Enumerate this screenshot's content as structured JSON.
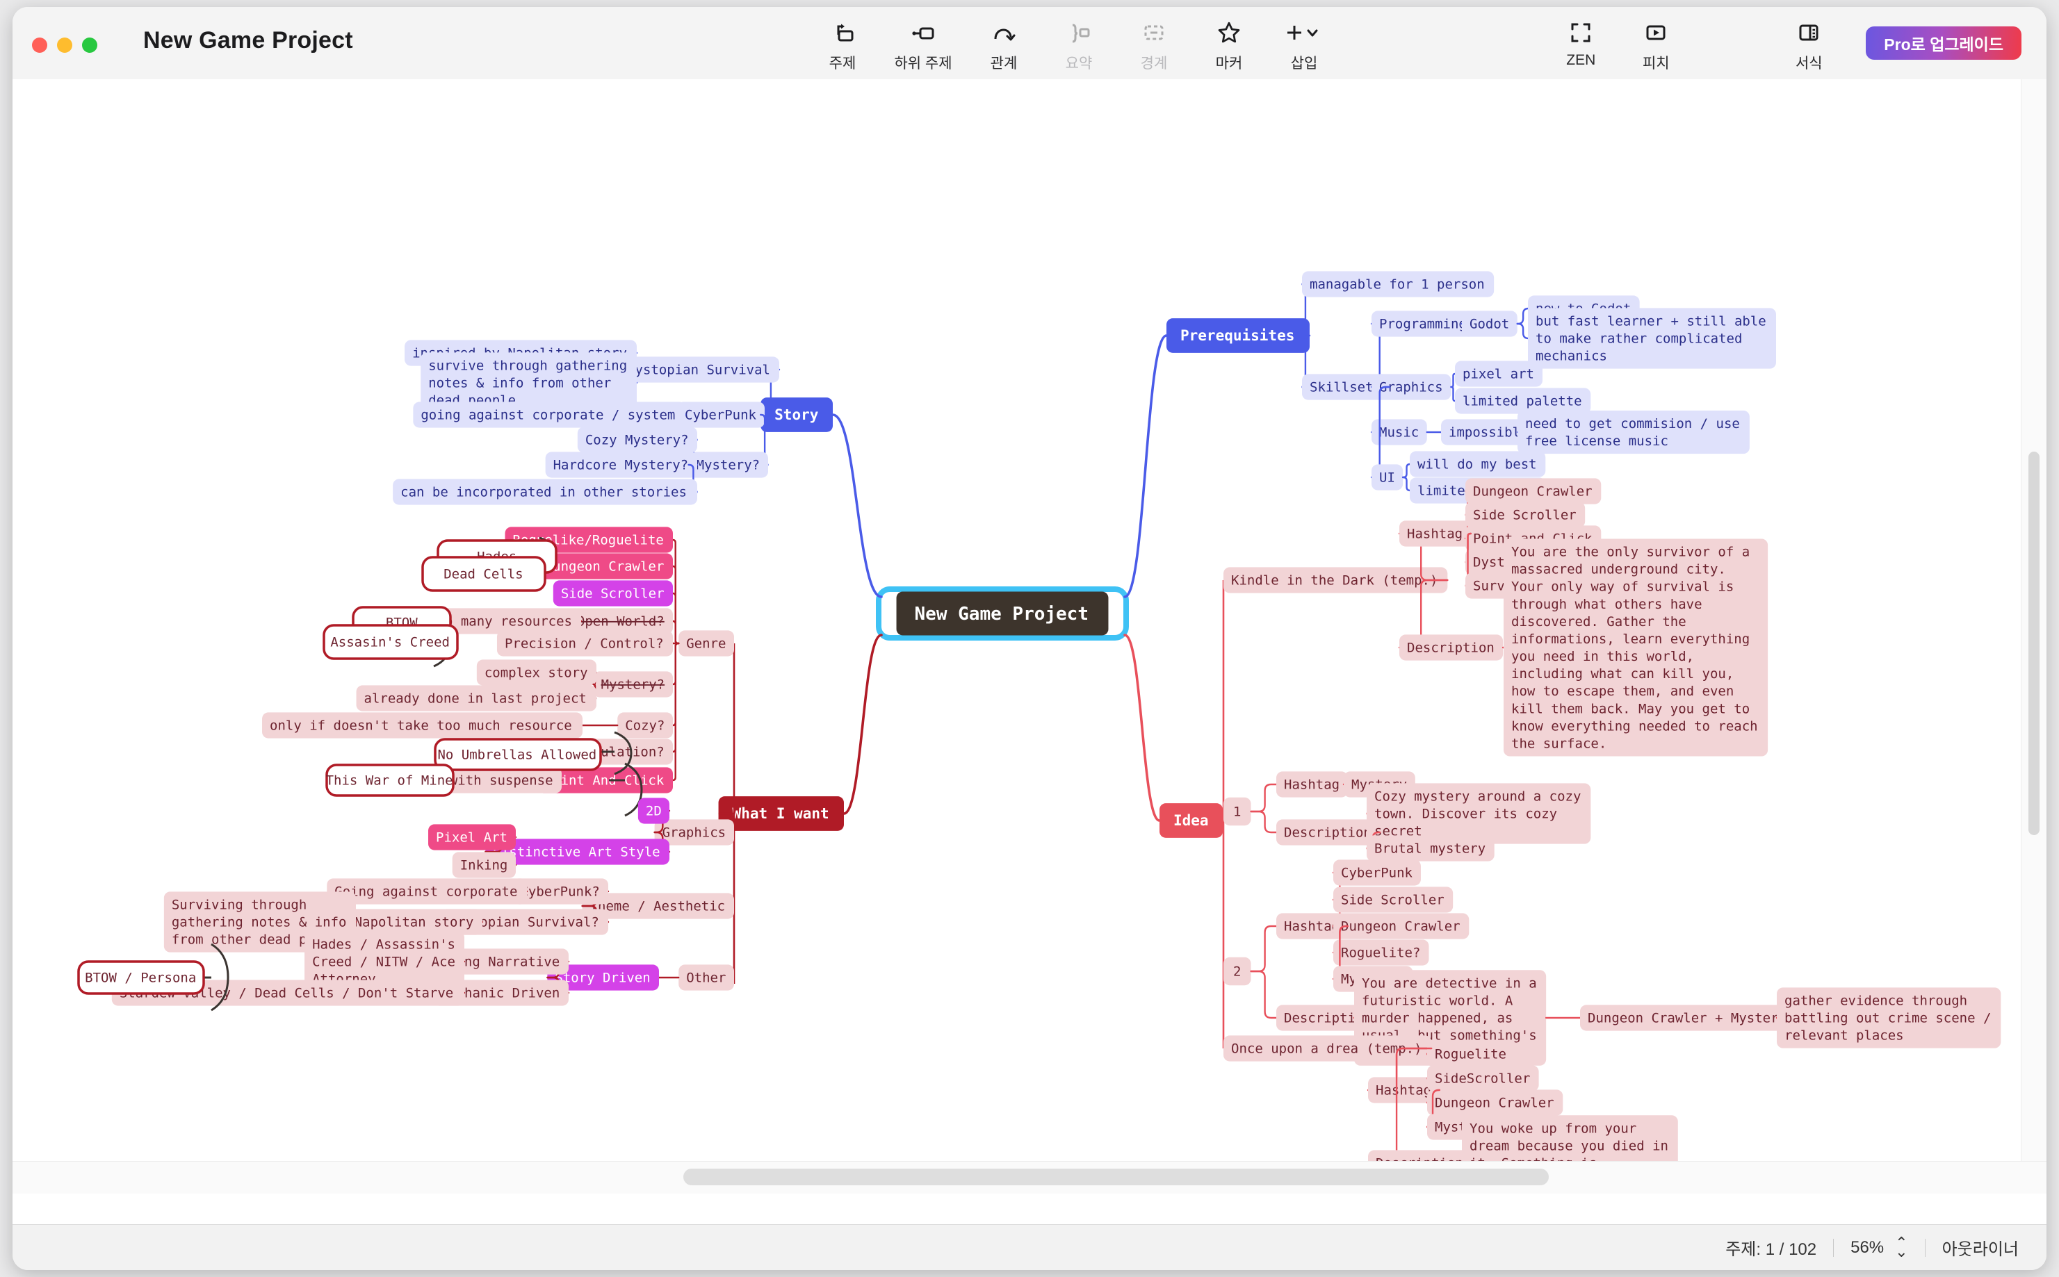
{
  "window": {
    "document_title": "New Game Project",
    "traffic_lights": [
      "close",
      "minimize",
      "zoom"
    ]
  },
  "toolbar": {
    "items": [
      {
        "label": "주제",
        "icon": "topic-icon",
        "disabled": false
      },
      {
        "label": "하위 주제",
        "icon": "subtopic-icon",
        "disabled": false
      },
      {
        "label": "관계",
        "icon": "relationship-icon",
        "disabled": false
      },
      {
        "label": "요약",
        "icon": "summary-icon",
        "disabled": true
      },
      {
        "label": "경계",
        "icon": "boundary-icon",
        "disabled": true
      },
      {
        "label": "마커",
        "icon": "star-marker-icon",
        "disabled": false
      },
      {
        "label": "삽입",
        "icon": "insert-plus-icon",
        "disabled": false
      }
    ],
    "right_items": [
      {
        "label": "ZEN",
        "icon": "zen-icon"
      },
      {
        "label": "피치",
        "icon": "pitch-play-icon"
      },
      {
        "label": "서식",
        "icon": "format-panel-icon"
      }
    ],
    "upgrade_label": "Pro로 업그레이드"
  },
  "statusbar": {
    "topic_count": "주제: 1 / 102",
    "zoom": "56%",
    "outliner": "아웃라이너",
    "stepper_icon": "chevron-up-down-icon"
  },
  "colors": {
    "root_fill": "#3d342c",
    "root_text": "#ffffff",
    "selection_ring": "#3fc2f5",
    "blue_branch": "#4a5be8",
    "blue_node": "#dfe1fb",
    "blue_text": "#2b2f8a",
    "dark_red": "#b01b26",
    "coral_red": "#e8505b",
    "pink_node": "#f2d4d6",
    "pink_text": "#6e2430",
    "hot_pink": "#ef4a87",
    "magenta": "#d442e8",
    "boundary_stroke": "#b01b26",
    "bracket_stroke": "#3a3430"
  },
  "mindmap": {
    "root": {
      "text": "New Game Project",
      "selected": true
    },
    "branches": [
      {
        "name": "Prerequisites",
        "color": "blue"
      },
      {
        "name": "Story",
        "color": "blue"
      },
      {
        "name": "What I want",
        "color": "dark_red"
      },
      {
        "name": "Idea",
        "color": "coral_red"
      }
    ],
    "nodes": {
      "prerequisites": "Prerequisites",
      "managable": "managable for 1 person",
      "skillsets": "Skillsets",
      "programming": "Programming",
      "godot": "Godot",
      "new_to_godot": "new to Godot",
      "fast_learner": "but fast learner + still able to make rather complicated mechanics",
      "graphics_pre": "Graphics",
      "pixel_art_pre": "pixel art",
      "limited_palette_1": "limited palette",
      "music": "Music",
      "impossible": "impossible",
      "commision": "need to get commision / use free license music",
      "ui": "UI",
      "will_do_best": "will do my best",
      "limited_palette_2": "limited palette",
      "story": "Story",
      "dystopian_survival": "Dystopian Survival",
      "inspired_napolitan": "inspired by Napolitan story",
      "survive_gathering": "survive through gathering notes & info from other dead people",
      "cyberpunk": "CyberPunk",
      "going_against": "going against corporate / system",
      "mystery_q": "Mystery?",
      "cozy_mystery_q": "Cozy Mystery?",
      "hardcore_mystery_q": "Hardcore Mystery?",
      "can_be_incorporated": "can be incorporated in other stories",
      "what_i_want": "What I want",
      "genre": "Genre",
      "roguelike": "Roguelike/Roguelite",
      "dungeon_crawler_g": "Dungeon Crawler",
      "side_scroller_g": "Side Scroller",
      "hades": "Hades",
      "dead_cells": "Dead Cells",
      "open_world_q": "Open World?",
      "too_many_resources": "too many resources",
      "btow": "BTOW",
      "assasins_creed": "Assasin's Creed",
      "precision_control_q": "Precision / Control?",
      "mystery_q2": "Mystery?",
      "complex_story": "complex story",
      "already_done": "already done in last project",
      "cozy_q": "Cozy?",
      "only_if_doesnt": "only if doesn't take too much resource",
      "simulation_q": "Simulation?",
      "no_umbrellas": "No Umbrellas Allowed",
      "point_and_click_g": "Point And Click",
      "with_suspense": "with suspense",
      "this_war_of_mine": "This War of Mine",
      "graphics_w": "Graphics",
      "two_d": "2D",
      "distinctive_art": "Distinctive Art Style",
      "pixel_art_w": "Pixel Art",
      "inking": "Inking",
      "theme_aesthetic": "Theme / Aesthetic",
      "cyberpunk_q": "CyberPunk?",
      "going_against_corp": "Going against corporate",
      "dystopian_survival_q": "Dystopian Survival?",
      "napolitan_story": "Napolitan story",
      "surviving_through": "Surviving through gathering notes & info from other dead people",
      "other": "Other",
      "story_driven": "Story Driven",
      "strong_narrative": "Strong Narrative",
      "hades_ac_nitw": "Hades / Assassin's Creed / NITW / Ace Attorney",
      "mechanic_driven": "Mechanic Driven",
      "stardew_dead_cells": "Stardew Valley / Dead Cells / Don't Starve",
      "btow_persona": "BTOW / Persona",
      "idea": "Idea",
      "kindle": "Kindle in the Dark (temp.)",
      "k_hashtag": "Hashtag",
      "k_dungeon_crawler": "Dungeon Crawler",
      "k_side_scroller": "Side Scroller",
      "k_point_and_click": "Point and Click",
      "k_dystopia": "Dystopia",
      "k_survival": "Survival",
      "k_description_lbl": "Description",
      "k_description": "You are the only survivor of a massacred underground city. Your only way of survival is through what others have discovered. Gather the informations, learn everything you need in this world, including what can kill you, how to escape them, and even kill them back. May you get to know everything needed to reach the surface.",
      "idea1": "1",
      "i1_hashtag": "Hashtag",
      "i1_mystery": "Mystery",
      "i1_description_lbl": "Description",
      "i1_cozy_mystery": "Cozy mystery around a cozy town. Discover its cozy secret",
      "i1_brutal_mystery": "Brutal mystery",
      "idea2": "2",
      "i2_hashtag": "Hashtag",
      "i2_cyberpunk": "CyberPunk",
      "i2_side_scroller": "Side Scroller",
      "i2_dungeon_crawler": "Dungeon Crawler",
      "i2_roguelite_q": "Roguelite?",
      "i2_mystery_q": "Mystery?",
      "i2_description_lbl": "Description",
      "i2_description": "You are detective in a futuristic world. A murder happened, as usual, but something's off this time.",
      "i2_dc_mystery_q": "Dungeon Crawler + Mystery?",
      "i2_gather_evidence": "gather evidence through battling out crime scene / relevant places",
      "once_upon": "Once upon a drea (temp.)",
      "o_hashtag": "Hashtag",
      "o_roguelite": "Roguelite",
      "o_sidescroller": "SideScroller",
      "o_dungeon_crawler": "Dungeon Crawler",
      "o_mystery": "Mystery",
      "o_description_lbl": "Description",
      "o_description": "You woke up from your dream because you died in it. Something is happening there, as well as when you are awake."
    }
  }
}
